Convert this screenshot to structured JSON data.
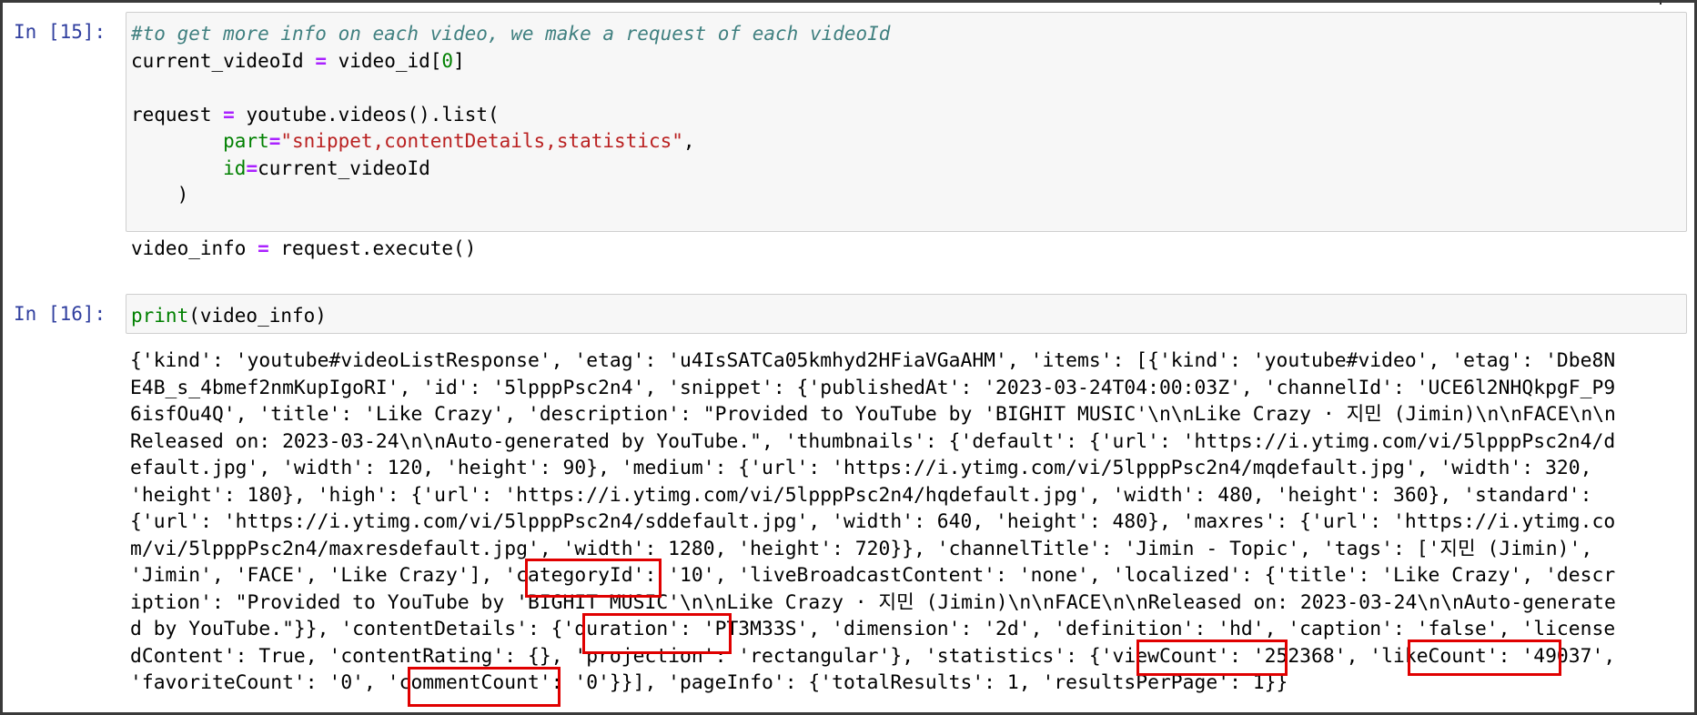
{
  "cells": [
    {
      "prompt": "In [15]:",
      "code": {
        "comment": "#to get more info on each video, we make a request of each videoId",
        "l2_var": "current_videoId",
        "l2_rest": "video_id[",
        "l2_idx": "0",
        "l2_close": "]",
        "l4_var": "request",
        "l4_rest": "youtube.videos().list(",
        "l5_param": "part",
        "l5_value": "\"snippet,contentDetails,statistics\"",
        "l5_comma": ",",
        "l6_param": "id",
        "l6_value": "current_videoId",
        "l7": ")",
        "l9_var": "video_info",
        "l9_rest": "request.execute()"
      }
    },
    {
      "prompt": "In [16]:",
      "code": {
        "func": "print",
        "args": "(video_info)"
      },
      "output_lines": [
        "{'kind': 'youtube#videoListResponse', 'etag': 'u4IsSATCa05kmhyd2HFiaVGaAHM', 'items': [{'kind': 'youtube#video', 'etag': 'Dbe8N",
        "E4B_s_4bmef2nmKupIgoRI', 'id': '5lpppPsc2n4', 'snippet': {'publishedAt': '2023-03-24T04:00:03Z', 'channelId': 'UCE6l2NHQkpgF_P9",
        "6isfOu4Q', 'title': 'Like Crazy', 'description': \"Provided to YouTube by 'BIGHIT MUSIC'\\n\\nLike Crazy · 지민 (Jimin)\\n\\nFACE\\n\\n",
        "Released on: 2023-03-24\\n\\nAuto-generated by YouTube.\", 'thumbnails': {'default': {'url': 'https://i.ytimg.com/vi/5lpppPsc2n4/d",
        "efault.jpg', 'width': 120, 'height': 90}, 'medium': {'url': 'https://i.ytimg.com/vi/5lpppPsc2n4/mqdefault.jpg', 'width': 320,",
        "'height': 180}, 'high': {'url': 'https://i.ytimg.com/vi/5lpppPsc2n4/hqdefault.jpg', 'width': 480, 'height': 360}, 'standard':",
        "{'url': 'https://i.ytimg.com/vi/5lpppPsc2n4/sddefault.jpg', 'width': 640, 'height': 480}, 'maxres': {'url': 'https://i.ytimg.co",
        "m/vi/5lpppPsc2n4/maxresdefault.jpg', 'width': 1280, 'height': 720}}, 'channelTitle': 'Jimin - Topic', 'tags': ['지민 (Jimin)',",
        "'Jimin', 'FACE', 'Like Crazy'], 'categoryId': '10', 'liveBroadcastContent': 'none', 'localized': {'title': 'Like Crazy', 'descr",
        "iption': \"Provided to YouTube by 'BIGHIT MUSIC'\\n\\nLike Crazy · 지민 (Jimin)\\n\\nFACE\\n\\nReleased on: 2023-03-24\\n\\nAuto-generate",
        "d by YouTube.\"}}, 'contentDetails': {'duration': 'PT3M33S', 'dimension': '2d', 'definition': 'hd', 'caption': 'false', 'license",
        "dContent': True, 'contentRating': {}, 'projection': 'rectangular'}, 'statistics': {'viewCount': '252368', 'likeCount': '49037',",
        "'favoriteCount': '0', 'commentCount': '0'}}], 'pageInfo': {'totalResults': 1, 'resultsPerPage': 1}}"
      ]
    }
  ],
  "highlighted_keys": [
    "categoryId",
    "duration",
    "viewCount",
    "likeCount",
    "commentCount"
  ],
  "colors": {
    "highlight_box": "#e00000",
    "prompt": "#303f9f",
    "comment": "#408080",
    "string": "#ba2121",
    "operator": "#aa22ff"
  }
}
